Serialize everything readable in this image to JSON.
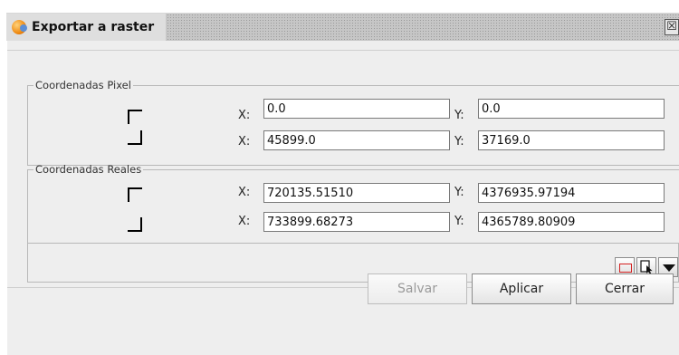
{
  "window": {
    "title": "Exportar a raster",
    "close_glyph": "☒"
  },
  "pixel_group": {
    "legend": "Coordenadas Pixel",
    "row1": {
      "x_label": "X:",
      "x_value": "0.0",
      "y_label": "Y:",
      "y_value": "0.0"
    },
    "row2": {
      "x_label": "X:",
      "x_value": "45899.0",
      "y_label": "Y:",
      "y_value": "37169.0"
    }
  },
  "real_group": {
    "legend": "Coordenadas Reales",
    "row1": {
      "x_label": "X:",
      "x_value": "720135.51510",
      "y_label": "Y:",
      "y_value": "4376935.97194"
    },
    "row2": {
      "x_label": "X:",
      "x_value": "733899.68273",
      "y_label": "Y:",
      "y_value": "4365789.80909"
    }
  },
  "tools": {
    "select_rect_icon": "rectangle-select-icon",
    "pointer_icon": "pointer-select-icon",
    "dropdown_icon": "dropdown-arrow-icon"
  },
  "buttons": {
    "save_label": "Salvar",
    "apply_label": "Aplicar",
    "close_label": "Cerrar"
  }
}
